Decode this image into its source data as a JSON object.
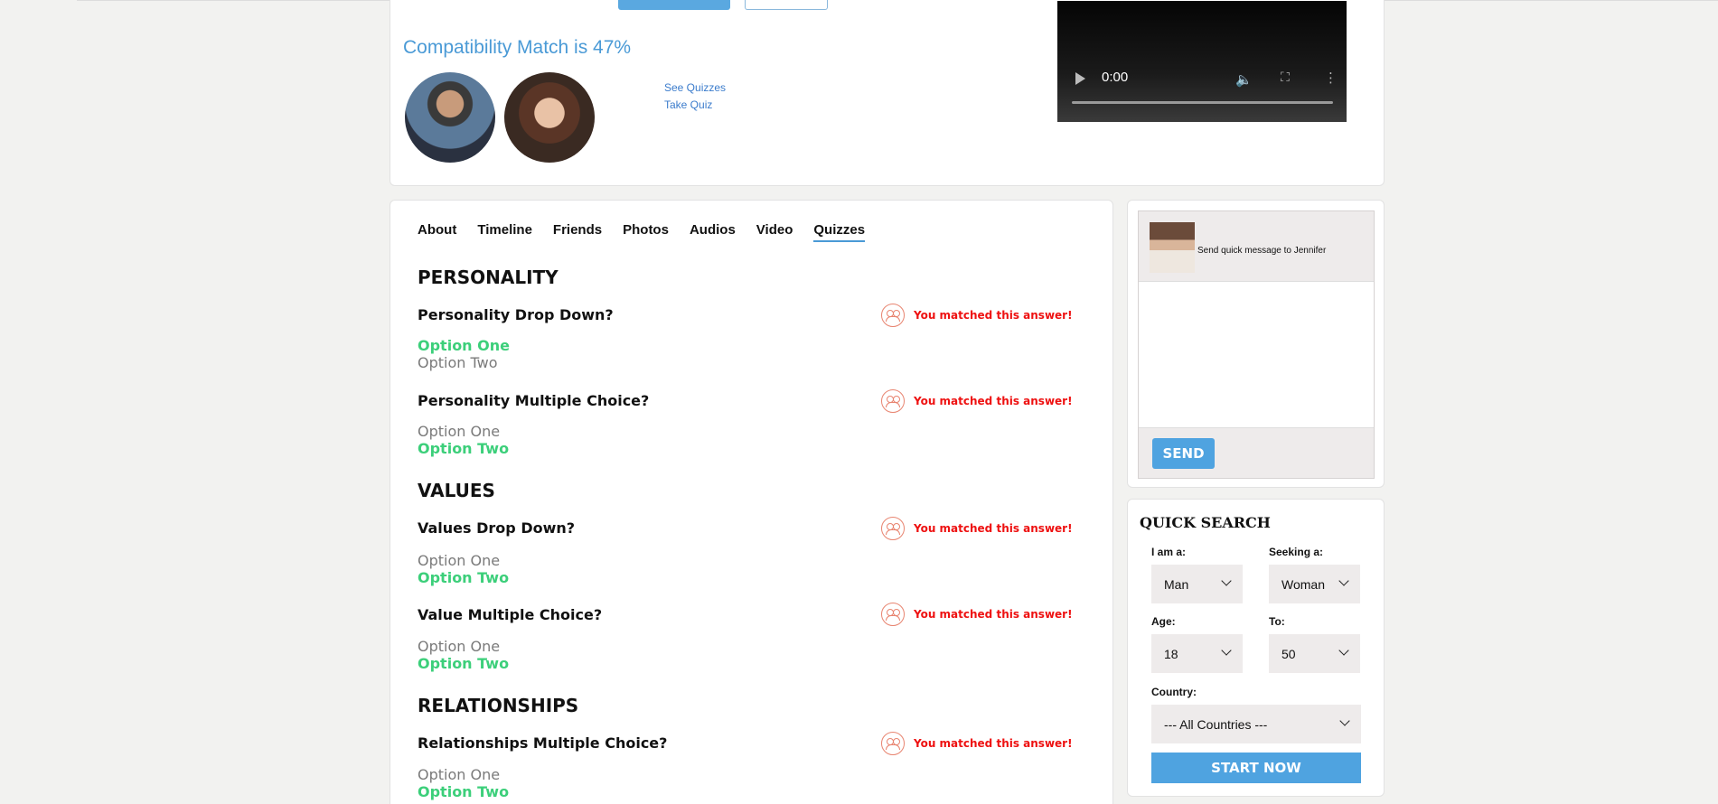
{
  "profile": {
    "compatibility_text": "Compatibility Match is 47%",
    "see_quizzes": "See Quizzes",
    "take_quiz": "Take Quiz",
    "video_time": "0:00"
  },
  "tabs": [
    {
      "label": "About"
    },
    {
      "label": "Timeline"
    },
    {
      "label": "Friends"
    },
    {
      "label": "Photos"
    },
    {
      "label": "Audios"
    },
    {
      "label": "Video"
    },
    {
      "label": "Quizzes",
      "active": true
    }
  ],
  "quizzes": {
    "match_text": "You matched this answer!",
    "sections": [
      {
        "title": "PERSONALITY",
        "questions": [
          {
            "title": "Personality Drop Down?",
            "options": [
              "Option One",
              "Option Two"
            ],
            "selected": 0
          },
          {
            "title": "Personality Multiple Choice?",
            "options": [
              "Option One",
              "Option Two"
            ],
            "selected": 1
          }
        ]
      },
      {
        "title": "VALUES",
        "questions": [
          {
            "title": "Values Drop Down?",
            "options": [
              "Option One",
              "Option Two"
            ],
            "selected": 1
          },
          {
            "title": "Value Multiple Choice?",
            "options": [
              "Option One",
              "Option Two"
            ],
            "selected": 1
          }
        ]
      },
      {
        "title": "RELATIONSHIPS",
        "questions": [
          {
            "title": "Relationships Multiple Choice?",
            "options": [
              "Option One",
              "Option Two"
            ],
            "selected": 1
          }
        ]
      }
    ]
  },
  "message": {
    "label": "Send quick message to  Jennifer",
    "send_label": "SEND"
  },
  "quick_search": {
    "title": "QUICK SEARCH",
    "i_am_label": "I am a:",
    "i_am_value": "Man",
    "seeking_label": "Seeking a:",
    "seeking_value": "Woman",
    "age_label": "Age:",
    "age_value": "18",
    "to_label": "To:",
    "to_value": "50",
    "country_label": "Country:",
    "country_value": "--- All Countries ---",
    "start_label": "START NOW"
  },
  "colors": {
    "accent": "#4fa3e0",
    "selected_option": "#3ccf7a",
    "match_red": "#ee1111",
    "link": "#3b7ccc"
  }
}
